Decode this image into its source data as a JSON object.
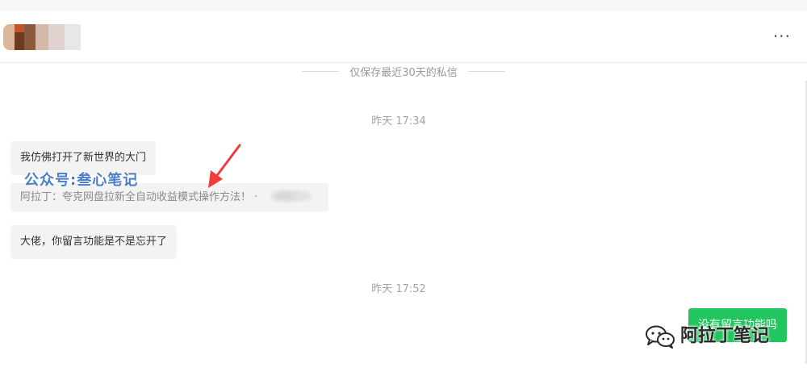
{
  "header": {
    "more_label": "···"
  },
  "notice": {
    "text": "仅保存最近30天的私信"
  },
  "conversation": {
    "timestamps": [
      "昨天 17:34",
      "昨天 17:52"
    ],
    "messages": [
      {
        "text": "我仿佛打开了新世界的大门"
      },
      {
        "text": "阿拉丁：夸克网盘拉新全自动收益模式操作方法！ ·"
      },
      {
        "text": "大佬，你留言功能是不是忘开了"
      }
    ]
  },
  "watermarks": {
    "top": "公众号:叁心笔记",
    "bottom": "阿拉丁笔记"
  },
  "reply_button": {
    "label": "没有留言功能吗"
  },
  "colors": {
    "accent_green": "#22c55e",
    "arrow_red": "#f03c3c",
    "watermark_blue": "#4a7ec8"
  },
  "icons": {
    "more": "more-horizontal-icon",
    "annotation": "red-arrow-icon",
    "wechat": "wechat-icon"
  }
}
